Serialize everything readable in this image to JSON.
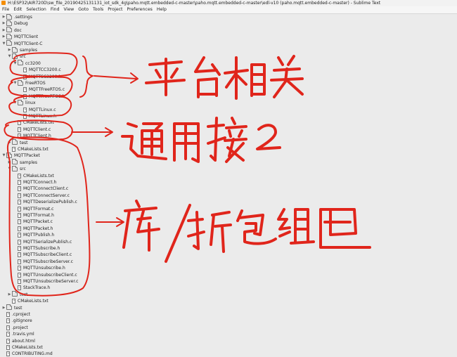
{
  "window": {
    "title": "H:\\ESP32\\AIR720D\\sw_file_20190425131131_iot_sdk_4g\\paho.mqtt.embedded-c-master\\paho.mqtt.embedded-c-master\\edl-v10 (paho.mqtt.embedded-c-master) - Sublime Text"
  },
  "menu": [
    "File",
    "Edit",
    "Selection",
    "Find",
    "View",
    "Goto",
    "Tools",
    "Project",
    "Preferences",
    "Help"
  ],
  "tree": [
    {
      "label": ".settings",
      "type": "folder",
      "depth": 1,
      "expanded": false
    },
    {
      "label": "Debug",
      "type": "folder",
      "depth": 1,
      "expanded": false
    },
    {
      "label": "doc",
      "type": "folder",
      "depth": 1,
      "expanded": false
    },
    {
      "label": "MQTTClient",
      "type": "folder",
      "depth": 1,
      "expanded": false
    },
    {
      "label": "MQTTClient-C",
      "type": "folder",
      "depth": 1,
      "expanded": true
    },
    {
      "label": "samples",
      "type": "folder",
      "depth": 2,
      "expanded": false
    },
    {
      "label": "src",
      "type": "folder",
      "depth": 2,
      "expanded": true
    },
    {
      "label": "cc3200",
      "type": "folder",
      "depth": 3,
      "expanded": true
    },
    {
      "label": "MQTTCC3200.c",
      "type": "file",
      "depth": 4
    },
    {
      "label": "MQTTCC3200.h",
      "type": "file",
      "depth": 4
    },
    {
      "label": "FreeRTOS",
      "type": "folder",
      "depth": 3,
      "expanded": true
    },
    {
      "label": "MQTTFreeRTOS.c",
      "type": "file",
      "depth": 4
    },
    {
      "label": "MQTTFreeRTOS.h",
      "type": "file",
      "depth": 4
    },
    {
      "label": "linux",
      "type": "folder",
      "depth": 3,
      "expanded": true
    },
    {
      "label": "MQTTLinux.c",
      "type": "file",
      "depth": 4
    },
    {
      "label": "MQTTLinux.h",
      "type": "file",
      "depth": 4
    },
    {
      "label": "CMakeLists.txt",
      "type": "file",
      "depth": 3
    },
    {
      "label": "MQTTClient.c",
      "type": "file",
      "depth": 3
    },
    {
      "label": "MQTTClient.h",
      "type": "file",
      "depth": 3
    },
    {
      "label": "test",
      "type": "folder",
      "depth": 2,
      "expanded": false
    },
    {
      "label": "CMakeLists.txt",
      "type": "file",
      "depth": 2
    },
    {
      "label": "MQTTPacket",
      "type": "folder",
      "depth": 1,
      "expanded": true
    },
    {
      "label": "samples",
      "type": "folder",
      "depth": 2,
      "expanded": false
    },
    {
      "label": "src",
      "type": "folder",
      "depth": 2,
      "expanded": true
    },
    {
      "label": "CMakeLists.txt",
      "type": "file",
      "depth": 3
    },
    {
      "label": "MQTTConnect.h",
      "type": "file",
      "depth": 3
    },
    {
      "label": "MQTTConnectClient.c",
      "type": "file",
      "depth": 3
    },
    {
      "label": "MQTTConnectServer.c",
      "type": "file",
      "depth": 3
    },
    {
      "label": "MQTTDeserializePublish.c",
      "type": "file",
      "depth": 3
    },
    {
      "label": "MQTTFormat.c",
      "type": "file",
      "depth": 3
    },
    {
      "label": "MQTTFormat.h",
      "type": "file",
      "depth": 3
    },
    {
      "label": "MQTTPacket.c",
      "type": "file",
      "depth": 3
    },
    {
      "label": "MQTTPacket.h",
      "type": "file",
      "depth": 3
    },
    {
      "label": "MQTTPublish.h",
      "type": "file",
      "depth": 3
    },
    {
      "label": "MQTTSerializePublish.c",
      "type": "file",
      "depth": 3
    },
    {
      "label": "MQTTSubscribe.h",
      "type": "file",
      "depth": 3
    },
    {
      "label": "MQTTSubscribeClient.c",
      "type": "file",
      "depth": 3
    },
    {
      "label": "MQTTSubscribeServer.c",
      "type": "file",
      "depth": 3
    },
    {
      "label": "MQTTUnsubscribe.h",
      "type": "file",
      "depth": 3
    },
    {
      "label": "MQTTUnsubscribeClient.c",
      "type": "file",
      "depth": 3
    },
    {
      "label": "MQTTUnsubscribeServer.c",
      "type": "file",
      "depth": 3
    },
    {
      "label": "StackTrace.h",
      "type": "file",
      "depth": 3
    },
    {
      "label": "test",
      "type": "folder",
      "depth": 2,
      "expanded": false
    },
    {
      "label": "CMakeLists.txt",
      "type": "file",
      "depth": 2
    },
    {
      "label": "test",
      "type": "folder",
      "depth": 1,
      "expanded": false
    },
    {
      "label": ".cproject",
      "type": "file",
      "depth": 1
    },
    {
      "label": ".gitignore",
      "type": "file",
      "depth": 1
    },
    {
      "label": ".project",
      "type": "file",
      "depth": 1
    },
    {
      "label": ".travis.yml",
      "type": "file",
      "depth": 1
    },
    {
      "label": "about.html",
      "type": "file",
      "depth": 1
    },
    {
      "label": "CMakeLists.txt",
      "type": "file",
      "depth": 1
    },
    {
      "label": "CONTRIBUTING.md",
      "type": "file",
      "depth": 1
    }
  ],
  "annotations": {
    "platform_note": "平台相关",
    "common_note": "通用接口",
    "library_note": "库/拆包组包"
  },
  "colors": {
    "ink": "#e0251b",
    "background": "#ebebeb",
    "text": "#222222"
  }
}
